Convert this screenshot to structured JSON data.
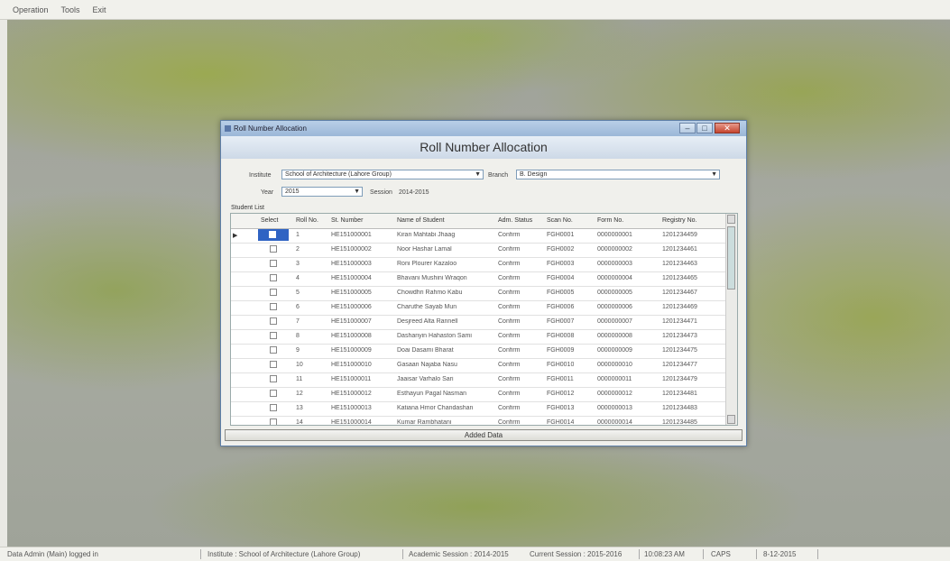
{
  "menubar": {
    "items": [
      "Operation",
      "Tools",
      "Exit"
    ]
  },
  "window": {
    "title": "Roll Number Allocation",
    "min_glyph": "–",
    "max_glyph": "□",
    "close_glyph": "✕",
    "header": "Roll Number Allocation",
    "form": {
      "institute_label": "Institute",
      "institute_value": "School of Architecture (Lahore Group)",
      "branch_label": "Branch",
      "branch_value": "B. Design",
      "year_label": "Year",
      "year_value": "2015",
      "session_label": "Session",
      "session_value": "2014-2015"
    },
    "section_label": "Student List",
    "grid": {
      "headers": [
        "Select",
        "Roll No.",
        "St. Number",
        "Name of Student",
        "Adm. Status",
        "Scan No.",
        "Form No.",
        "Registry No."
      ],
      "rows": [
        {
          "no": "1",
          "st": "HE151000001",
          "name": "Kiran Mahtabi Jhaag",
          "status": "Confirm",
          "scan": "FGH0001",
          "form": "0000000001",
          "reg": "1201234459"
        },
        {
          "no": "2",
          "st": "HE151000002",
          "name": "Noor Hashar Lamal",
          "status": "Confirm",
          "scan": "FGH0002",
          "form": "0000000002",
          "reg": "1201234461"
        },
        {
          "no": "3",
          "st": "HE151000003",
          "name": "Roni Plourer Kazaloo",
          "status": "Confirm",
          "scan": "FGH0003",
          "form": "0000000003",
          "reg": "1201234463"
        },
        {
          "no": "4",
          "st": "HE151000004",
          "name": "Bhavani Mushini Wraqon",
          "status": "Confirm",
          "scan": "FGH0004",
          "form": "0000000004",
          "reg": "1201234465"
        },
        {
          "no": "5",
          "st": "HE151000005",
          "name": "Chowdhri Rahmo Kabu",
          "status": "Confirm",
          "scan": "FGH0005",
          "form": "0000000005",
          "reg": "1201234467"
        },
        {
          "no": "6",
          "st": "HE151000006",
          "name": "Charuthe Sayab Mun",
          "status": "Confirm",
          "scan": "FGH0006",
          "form": "0000000006",
          "reg": "1201234469"
        },
        {
          "no": "7",
          "st": "HE151000007",
          "name": "Desjreed Alta Rannell",
          "status": "Confirm",
          "scan": "FGH0007",
          "form": "0000000007",
          "reg": "1201234471"
        },
        {
          "no": "8",
          "st": "HE151000008",
          "name": "Dashanyin Hahaston Sami",
          "status": "Confirm",
          "scan": "FGH0008",
          "form": "0000000008",
          "reg": "1201234473"
        },
        {
          "no": "9",
          "st": "HE151000009",
          "name": "Doai Dasami Bharat",
          "status": "Confirm",
          "scan": "FGH0009",
          "form": "0000000009",
          "reg": "1201234475"
        },
        {
          "no": "10",
          "st": "HE151000010",
          "name": "Gasaan Najaba Nasu",
          "status": "Confirm",
          "scan": "FGH0010",
          "form": "0000000010",
          "reg": "1201234477"
        },
        {
          "no": "11",
          "st": "HE151000011",
          "name": "Jaaisar Varhalo Sari",
          "status": "Confirm",
          "scan": "FGH0011",
          "form": "0000000011",
          "reg": "1201234479"
        },
        {
          "no": "12",
          "st": "HE151000012",
          "name": "Esthayun Pagal Nasman",
          "status": "Confirm",
          "scan": "FGH0012",
          "form": "0000000012",
          "reg": "1201234481"
        },
        {
          "no": "13",
          "st": "HE151000013",
          "name": "Katiana Hmor Chandashan",
          "status": "Confirm",
          "scan": "FGH0013",
          "form": "0000000013",
          "reg": "1201234483"
        },
        {
          "no": "14",
          "st": "HE151000014",
          "name": "Kumar Rambhatani",
          "status": "Confirm",
          "scan": "FGH0014",
          "form": "0000000014",
          "reg": "1201234485"
        }
      ]
    },
    "add_button": "Added Data"
  },
  "statusbar": {
    "user": "Data Admin (Main) logged in",
    "institute": "Institute : School of Architecture (Lahore Group)",
    "academic_session": "Academic Session : 2014-2015",
    "current_session": "Current Session : 2015-2016",
    "time": "10:08:23 AM",
    "caps": "CAPS",
    "date": "8-12-2015"
  }
}
